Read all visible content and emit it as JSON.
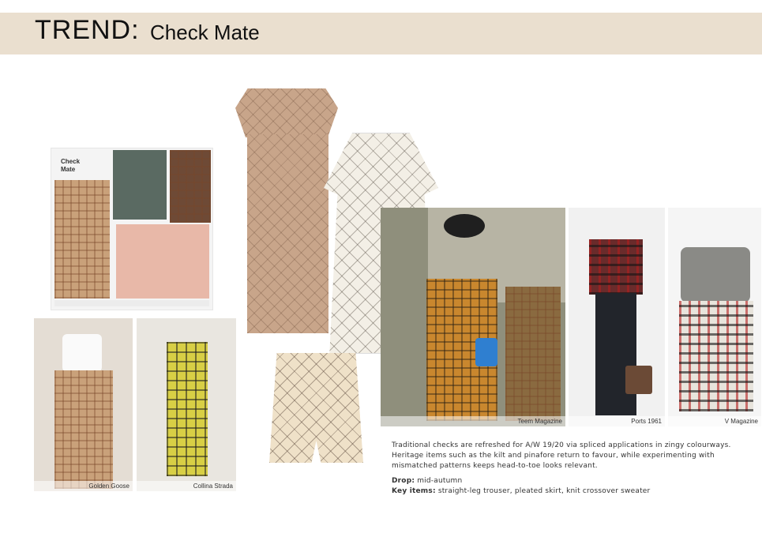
{
  "header": {
    "trend_label": "TREND:",
    "trend_name": "Check Mate"
  },
  "moodboard": {
    "title": "Check Mate"
  },
  "captions": {
    "golden_goose": "Golden Goose",
    "collina_strada": "Collina Strada",
    "teen_magazine": "Teem Magazine",
    "ports_1961": "Ports 1961",
    "v_magazine": "V Magazine"
  },
  "description": "Traditional checks are refreshed for A/W 19/20 via spliced applications in zingy colourways. Heritage items such as the kilt and pinafore return to favour, while experimenting with mismatched patterns keeps head-to-toe looks relevant.",
  "drop": {
    "label": "Drop:",
    "value": "mid-autumn"
  },
  "key_items": {
    "label": "Key items:",
    "value": "straight-leg trouser, pleated skirt, knit crossover sweater"
  },
  "colors": {
    "header_band": "#eadfcf",
    "text": "#333333"
  }
}
